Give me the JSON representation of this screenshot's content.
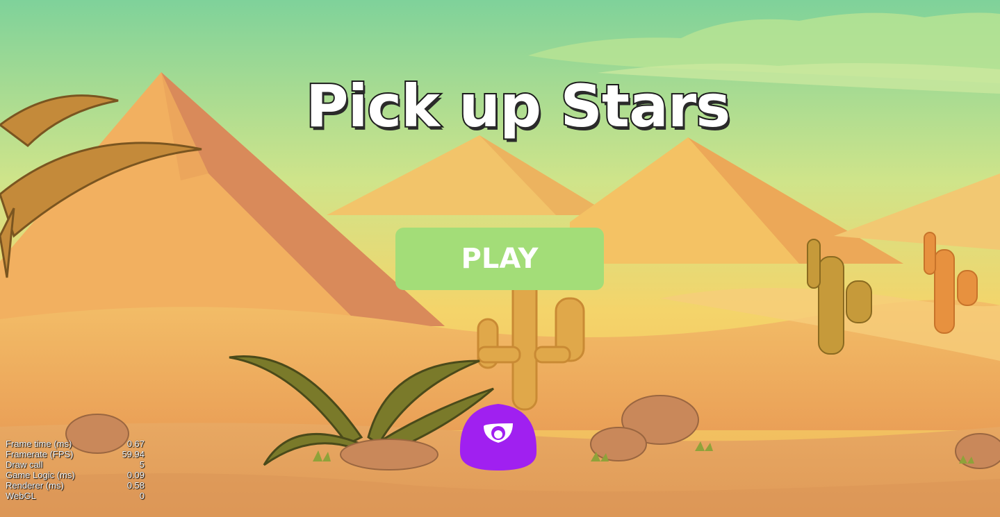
{
  "game": {
    "title": "Pick up Stars",
    "play_label": "PLAY"
  },
  "player": {
    "icon": "purple-blob-character-icon",
    "color": "#a020f0"
  },
  "stats": [
    {
      "label": "Frame time (ms)",
      "value": "0.67"
    },
    {
      "label": "Framerate (FPS)",
      "value": "59.94"
    },
    {
      "label": "Draw call",
      "value": "5"
    },
    {
      "label": "Game Logic (ms)",
      "value": "0.09"
    },
    {
      "label": "Renderer (ms)",
      "value": "0.58"
    },
    {
      "label": "WebGL",
      "value": "0"
    }
  ],
  "colors": {
    "sky_top": "#7fd29a",
    "sky_bottom": "#f2d86a",
    "sand": "#e9a860",
    "button": "#a3dd78",
    "player": "#a020f0"
  }
}
